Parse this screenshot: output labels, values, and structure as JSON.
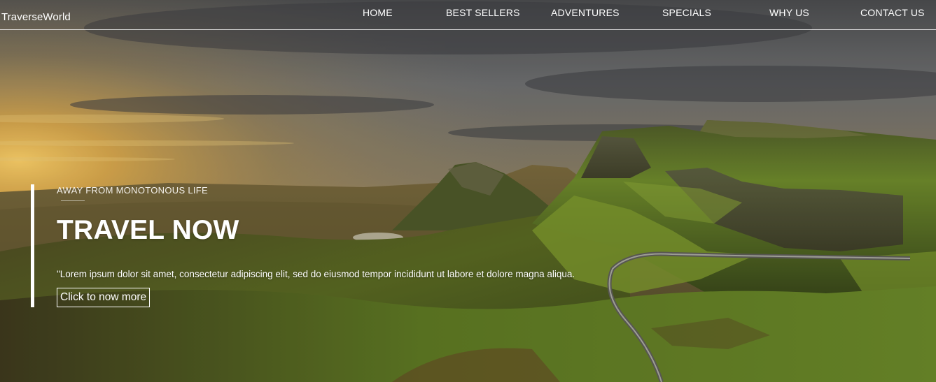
{
  "site": {
    "brand": "TraverseWorld"
  },
  "nav": {
    "items": [
      {
        "label": "HOME"
      },
      {
        "label": "BEST SELLERS"
      },
      {
        "label": "ADVENTURES"
      },
      {
        "label": "SPECIALS"
      },
      {
        "label": "WHY US"
      },
      {
        "label": "CONTACT US"
      }
    ]
  },
  "hero": {
    "kicker": "AWAY FROM MONOTONOUS LIFE",
    "headline": "TRAVEL NOW",
    "lead": "\"Lorem ipsum dolor sit amet, consectetur adipiscing elit, sed do eiusmod tempor incididunt ut labore et dolore magna aliqua.",
    "cta_label": "Click to now more"
  },
  "colors": {
    "text": "#ffffff",
    "sky": "#6b6d70",
    "sunset": "#e6b54a",
    "grass": "#7e9a2e"
  }
}
